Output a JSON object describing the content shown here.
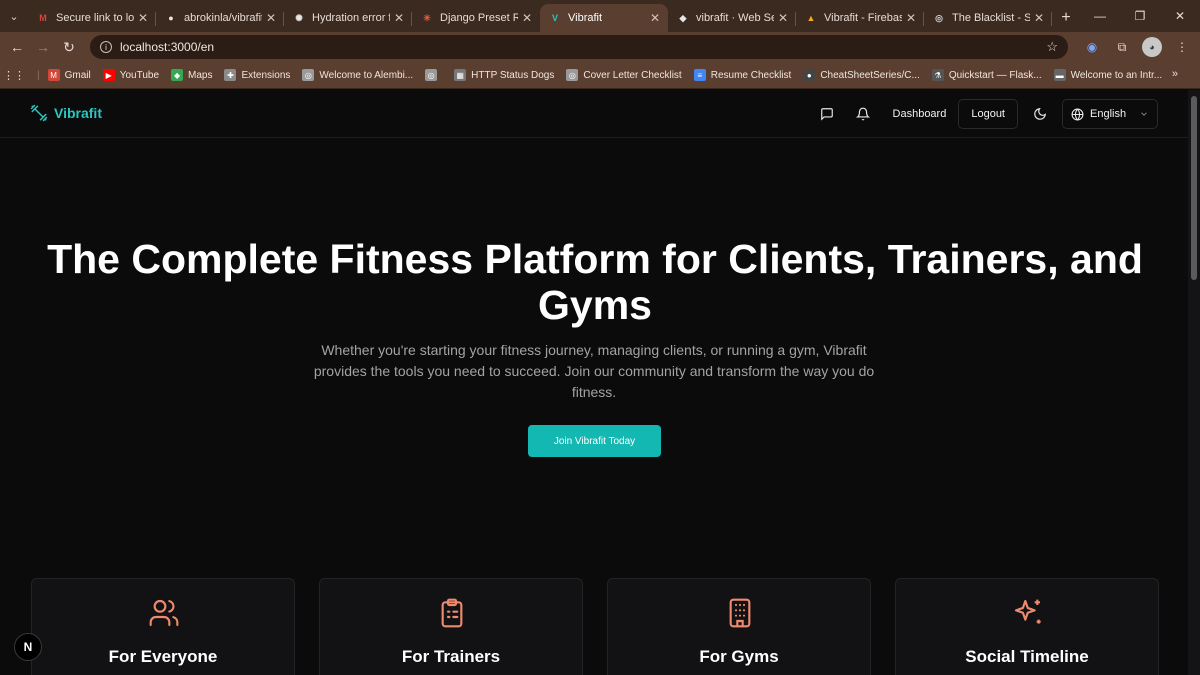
{
  "browser": {
    "tabs": [
      {
        "title": "Secure link to log",
        "icon": "gmail-icon",
        "icon_color": "#d44638",
        "glyph": "M"
      },
      {
        "title": "abrokinla/vibrafit_",
        "icon": "github-icon",
        "icon_color": "#e6e6e6",
        "glyph": "●"
      },
      {
        "title": "Hydration error fix",
        "icon": "openai-icon",
        "icon_color": "#e6e6e6",
        "glyph": "✺"
      },
      {
        "title": "Django Preset Ro",
        "icon": "asterisk-icon",
        "icon_color": "#e8603c",
        "glyph": "✳"
      },
      {
        "title": "Vibrafit",
        "icon": "vibrafit-icon",
        "icon_color": "#2cc6c0",
        "glyph": "V"
      },
      {
        "title": "vibrafit · Web Ser",
        "icon": "render-icon",
        "icon_color": "#e6e6e6",
        "glyph": "◆"
      },
      {
        "title": "Vibrafit - Firebase",
        "icon": "firebase-icon",
        "icon_color": "#f5a623",
        "glyph": "▲"
      },
      {
        "title": "The Blacklist - Sea",
        "icon": "globe-icon",
        "icon_color": "#cfcfcf",
        "glyph": "◎"
      }
    ],
    "active_tab": 4,
    "url": "localhost:3000/en",
    "bookmarks": [
      {
        "label": "Gmail",
        "icon": "gmail-icon",
        "color": "#d44638",
        "glyph": "M"
      },
      {
        "label": "YouTube",
        "icon": "youtube-icon",
        "color": "#ff0000",
        "glyph": "▶"
      },
      {
        "label": "Maps",
        "icon": "maps-icon",
        "color": "#34a853",
        "glyph": "◆"
      },
      {
        "label": "Extensions",
        "icon": "puzzle-icon",
        "color": "#8a8a8a",
        "glyph": "✚"
      },
      {
        "label": "Welcome to Alembi...",
        "icon": "globe-icon",
        "color": "#9a9a9a",
        "glyph": "◎"
      },
      {
        "label": "",
        "icon": "globe-icon",
        "color": "#9a9a9a",
        "glyph": "◎"
      },
      {
        "label": "HTTP Status Dogs",
        "icon": "dog-icon",
        "color": "#777777",
        "glyph": "▦"
      },
      {
        "label": "Cover Letter Checklist",
        "icon": "globe-icon",
        "color": "#9a9a9a",
        "glyph": "◎"
      },
      {
        "label": "Resume Checklist",
        "icon": "docs-icon",
        "color": "#4285f4",
        "glyph": "≡"
      },
      {
        "label": "CheatSheetSeries/C...",
        "icon": "github-icon",
        "color": "#444444",
        "glyph": "●"
      },
      {
        "label": "Quickstart — Flask...",
        "icon": "flask-icon",
        "color": "#555555",
        "glyph": "⚗"
      },
      {
        "label": "Welcome to an Intr...",
        "icon": "terminal-icon",
        "color": "#666666",
        "glyph": "▬"
      }
    ]
  },
  "app": {
    "brand": "Vibrafit",
    "brand_color": "#2cc6c0",
    "nav": {
      "dashboard": "Dashboard",
      "logout": "Logout",
      "language": "English"
    },
    "hero": {
      "title": "The Complete Fitness Platform for Clients, Trainers, and Gyms",
      "subtitle": "Whether you're starting your fitness journey, managing clients, or running a gym, Vibrafit provides the tools you need to succeed. Join our community and transform the way you do fitness.",
      "cta": "Join Vibrafit Today",
      "cta_color": "#13b8b2"
    },
    "features": [
      {
        "title": "For Everyone",
        "icon": "users-icon"
      },
      {
        "title": "For Trainers",
        "icon": "clipboard-icon"
      },
      {
        "title": "For Gyms",
        "icon": "building-icon"
      },
      {
        "title": "Social Timeline",
        "icon": "sparkles-icon"
      }
    ],
    "feature_icon_color": "#ef8a6d",
    "dev_badge": "N"
  }
}
